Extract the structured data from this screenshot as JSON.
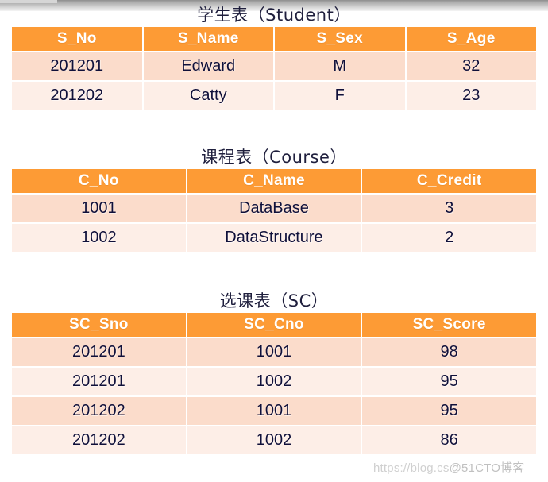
{
  "page": {
    "background": "#ffffff",
    "accent_orange": "#fd9b35",
    "row_odd": "#fbdccb",
    "row_even": "#fdeee7"
  },
  "watermark": {
    "url_part": "https://blog.cs",
    "site_part": "@51CTO博客"
  },
  "tables": [
    {
      "title": "学生表（Student）",
      "columns": [
        "S_No",
        "S_Name",
        "S_Sex",
        "S_Age"
      ],
      "rows": [
        [
          "201201",
          "Edward",
          "M",
          "32"
        ],
        [
          "201202",
          "Catty",
          "F",
          "23"
        ]
      ]
    },
    {
      "title": "课程表（Course）",
      "columns": [
        "C_No",
        "C_Name",
        "C_Credit"
      ],
      "rows": [
        [
          "1001",
          "DataBase",
          "3"
        ],
        [
          "1002",
          "DataStructure",
          "2"
        ]
      ]
    },
    {
      "title": "选课表（SC）",
      "columns": [
        "SC_Sno",
        "SC_Cno",
        "SC_Score"
      ],
      "rows": [
        [
          "201201",
          "1001",
          "98"
        ],
        [
          "201201",
          "1002",
          "95"
        ],
        [
          "201202",
          "1001",
          "95"
        ],
        [
          "201202",
          "1002",
          "86"
        ]
      ]
    }
  ]
}
